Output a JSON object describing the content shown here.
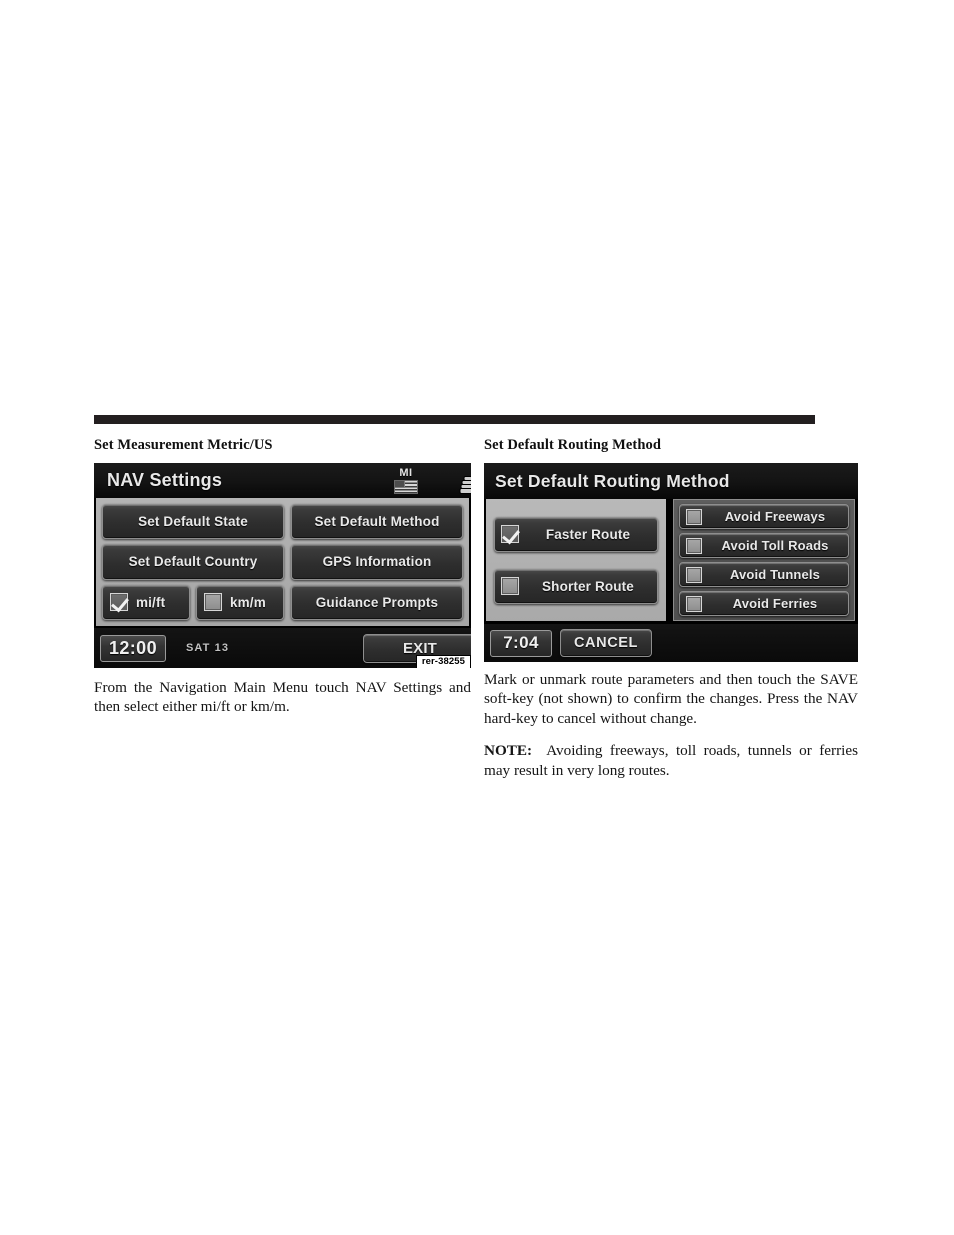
{
  "page": {
    "left_heading": "Set Measurement Metric/US",
    "right_heading": "Set Default Routing Method"
  },
  "nav_settings_screen": {
    "title": "NAV Settings",
    "status_icons": {
      "unit_label": "MI",
      "flag_icon": "us-flag-icon",
      "vehicle_icon": "vehicle-front-icon"
    },
    "buttons": [
      {
        "label": "Set Default State"
      },
      {
        "label": "Set Default Method"
      },
      {
        "label": "Set Default Country"
      },
      {
        "label": "GPS Information"
      },
      {
        "label": "Guidance Prompts"
      }
    ],
    "unit_options": [
      {
        "label": "mi/ft",
        "checked": true
      },
      {
        "label": "km/m",
        "checked": false
      }
    ],
    "bottom_bar": {
      "clock": "12:00",
      "date": "SAT  13",
      "exit_label": "EXIT"
    },
    "figure_number": "rer-38255"
  },
  "routing_method_screen": {
    "title": "Set Default Routing Method",
    "route_options": [
      {
        "label": "Faster Route",
        "checked": true
      },
      {
        "label": "Shorter Route",
        "checked": false
      }
    ],
    "avoid_options": [
      {
        "label": "Avoid Freeways",
        "checked": false
      },
      {
        "label": "Avoid Toll Roads",
        "checked": false
      },
      {
        "label": "Avoid Tunnels",
        "checked": false
      },
      {
        "label": "Avoid Ferries",
        "checked": false
      }
    ],
    "bottom_bar": {
      "clock": "7:04",
      "cancel_label": "CANCEL"
    }
  },
  "left_copy": {
    "paragraph_1": "From the Navigation Main Menu touch NAV Settings and then select either mi/ft or km/m."
  },
  "right_copy": {
    "paragraph_1": "Mark or unmark route parameters and then touch the SAVE soft-key (not shown) to confirm the changes. Press the NAV hard-key to cancel without change.",
    "note_label": "NOTE:",
    "note_text": "Avoiding freeways, toll roads, tunnels or ferries may result in very long routes."
  }
}
